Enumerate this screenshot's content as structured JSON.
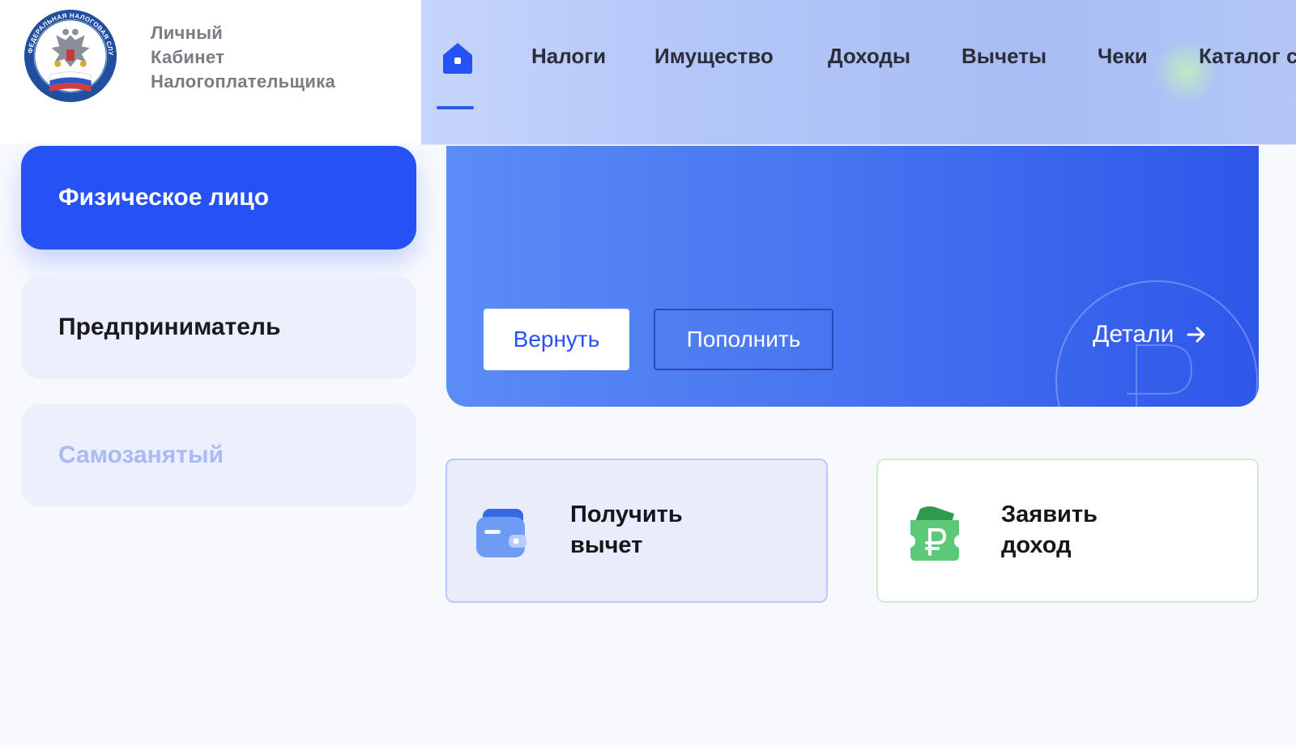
{
  "header": {
    "brand_lines": [
      "Личный",
      "Кабинет",
      "Налогоплательщика"
    ],
    "emblem_text": "ФЕДЕРАЛЬНАЯ НАЛОГОВАЯ СЛУЖБА"
  },
  "nav": {
    "home_icon": "home-icon",
    "items": [
      {
        "label": "Налоги"
      },
      {
        "label": "Имущество"
      },
      {
        "label": "Доходы"
      },
      {
        "label": "Вычеты"
      },
      {
        "label": "Чеки"
      },
      {
        "label": "Каталог с"
      }
    ]
  },
  "sidebar": {
    "items": [
      {
        "label": "Физическое лицо",
        "state": "active"
      },
      {
        "label": "Предприниматель"
      },
      {
        "label": "Самозанятый"
      }
    ]
  },
  "banner": {
    "return_label": "Вернуть",
    "topup_label": "Пополнить",
    "details_label": "Детали",
    "decor_icon": "ruble-icon"
  },
  "actions": {
    "deduction": {
      "title_line1": "Получить",
      "title_line2": "вычет",
      "icon": "wallet-icon"
    },
    "income": {
      "title_line1": "Заявить",
      "title_line2": "доход",
      "icon": "ruble-ticket-icon"
    }
  },
  "colors": {
    "primary": "#2652f5",
    "sidebar_inactive": "#eceffc",
    "text_dark": "#14161c",
    "selfemployed_text": "#a9baf4",
    "income_accent": "#4cc46a"
  }
}
